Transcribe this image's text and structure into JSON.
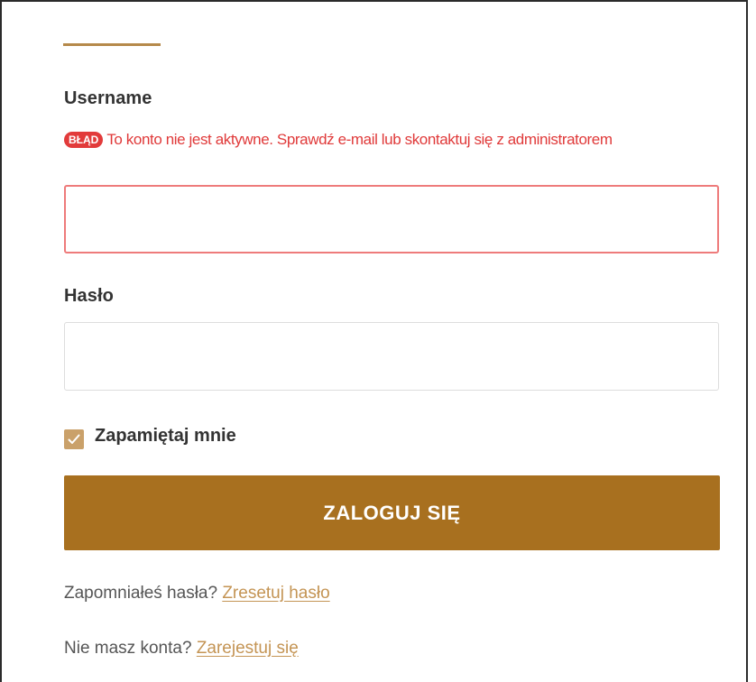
{
  "form": {
    "username_label": "Username",
    "error_badge": "BŁĄD",
    "error_message": "To konto nie jest aktywne. Sprawdź e-mail lub skontaktuj się z administratorem",
    "username_value": "",
    "password_label": "Hasło",
    "password_value": "",
    "remember_label": "Zapamiętaj mnie",
    "remember_checked": true,
    "login_button": "ZALOGUJ SIĘ"
  },
  "footer": {
    "forgot_text": "Zapomniałeś hasła?",
    "forgot_link": "Zresetuj hasło",
    "register_text": "Nie masz konta?",
    "register_link": "Zarejestuj się"
  },
  "colors": {
    "accent": "#b5894a",
    "button": "#a8701f",
    "error": "#e03a3a",
    "checkbox": "#caa16a",
    "link": "#c49454"
  },
  "icons": {
    "checkbox_mark": "check-icon"
  }
}
